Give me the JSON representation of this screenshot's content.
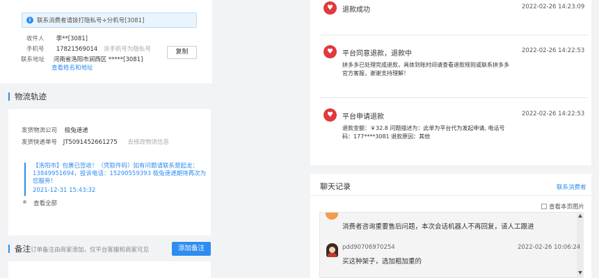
{
  "receiver": {
    "notice": "联系消费者请拨打隐私号+分机号[3081]",
    "name_label": "收件人",
    "name_value": "李**[3081]",
    "phone_label": "手机号",
    "phone_value": "17821569014",
    "phone_note": "该手机号为隐私号",
    "address_label": "联系地址",
    "address_value": "河南省洛阳市涧西区 *****[3081]",
    "view_full": "查看姓名和地址",
    "copy_label": "复制"
  },
  "logistics": {
    "section_title": "物流轨迹",
    "company_label": "发货物流公司",
    "company_value": "极兔速递",
    "tracking_label": "发货快递单号",
    "tracking_value": "JT5091452661275",
    "tracking_edit": "去修改物流信息",
    "latest_text": "【洛阳市】包裹已签收！（凭取件码）如有问题请联系楚起龙：13849951694，投诉电话：15290559393 极兔速递期待再次为您服务！",
    "latest_time": "2021-12-31 15:43:32",
    "view_all": "查看全部"
  },
  "notes": {
    "section_title": "备注",
    "hint": "订单备注由商家添加，仅平台客服和商家可见",
    "add_label": "添加备注"
  },
  "refund_events": [
    {
      "title": "退款成功",
      "time": "2022-02-26 14:23:09",
      "desc": ""
    },
    {
      "title": "平台同意退款，退款中",
      "time": "2022-02-26 14:22:53",
      "desc": "拼多多已处理完成退款，具体到账时间请查看退款规则或联系拼多多官方客服，谢谢支持理解！"
    },
    {
      "title": "平台申请退款",
      "time": "2022-02-26 14:22:53",
      "desc": "退款金额：￥32.8 问题描述为：此单为平台代为发起申请, 电话号码：177****3081 退款原因：其他"
    }
  ],
  "chat": {
    "title": "聊天记录",
    "contact": "联系消费者",
    "only_page_images": "查看本页图片",
    "system_msg": "消费者咨询重要售后问题，本次会话机器人不再回复，请人工跟进",
    "messages": [
      {
        "sender": "pdd90706970254",
        "time": "2022-02-26 10:06:24",
        "text": "买这种架子，选加粗加重的"
      }
    ]
  },
  "colors": {
    "accent": "#2d8cf0",
    "brand_red": "#e0393e"
  }
}
